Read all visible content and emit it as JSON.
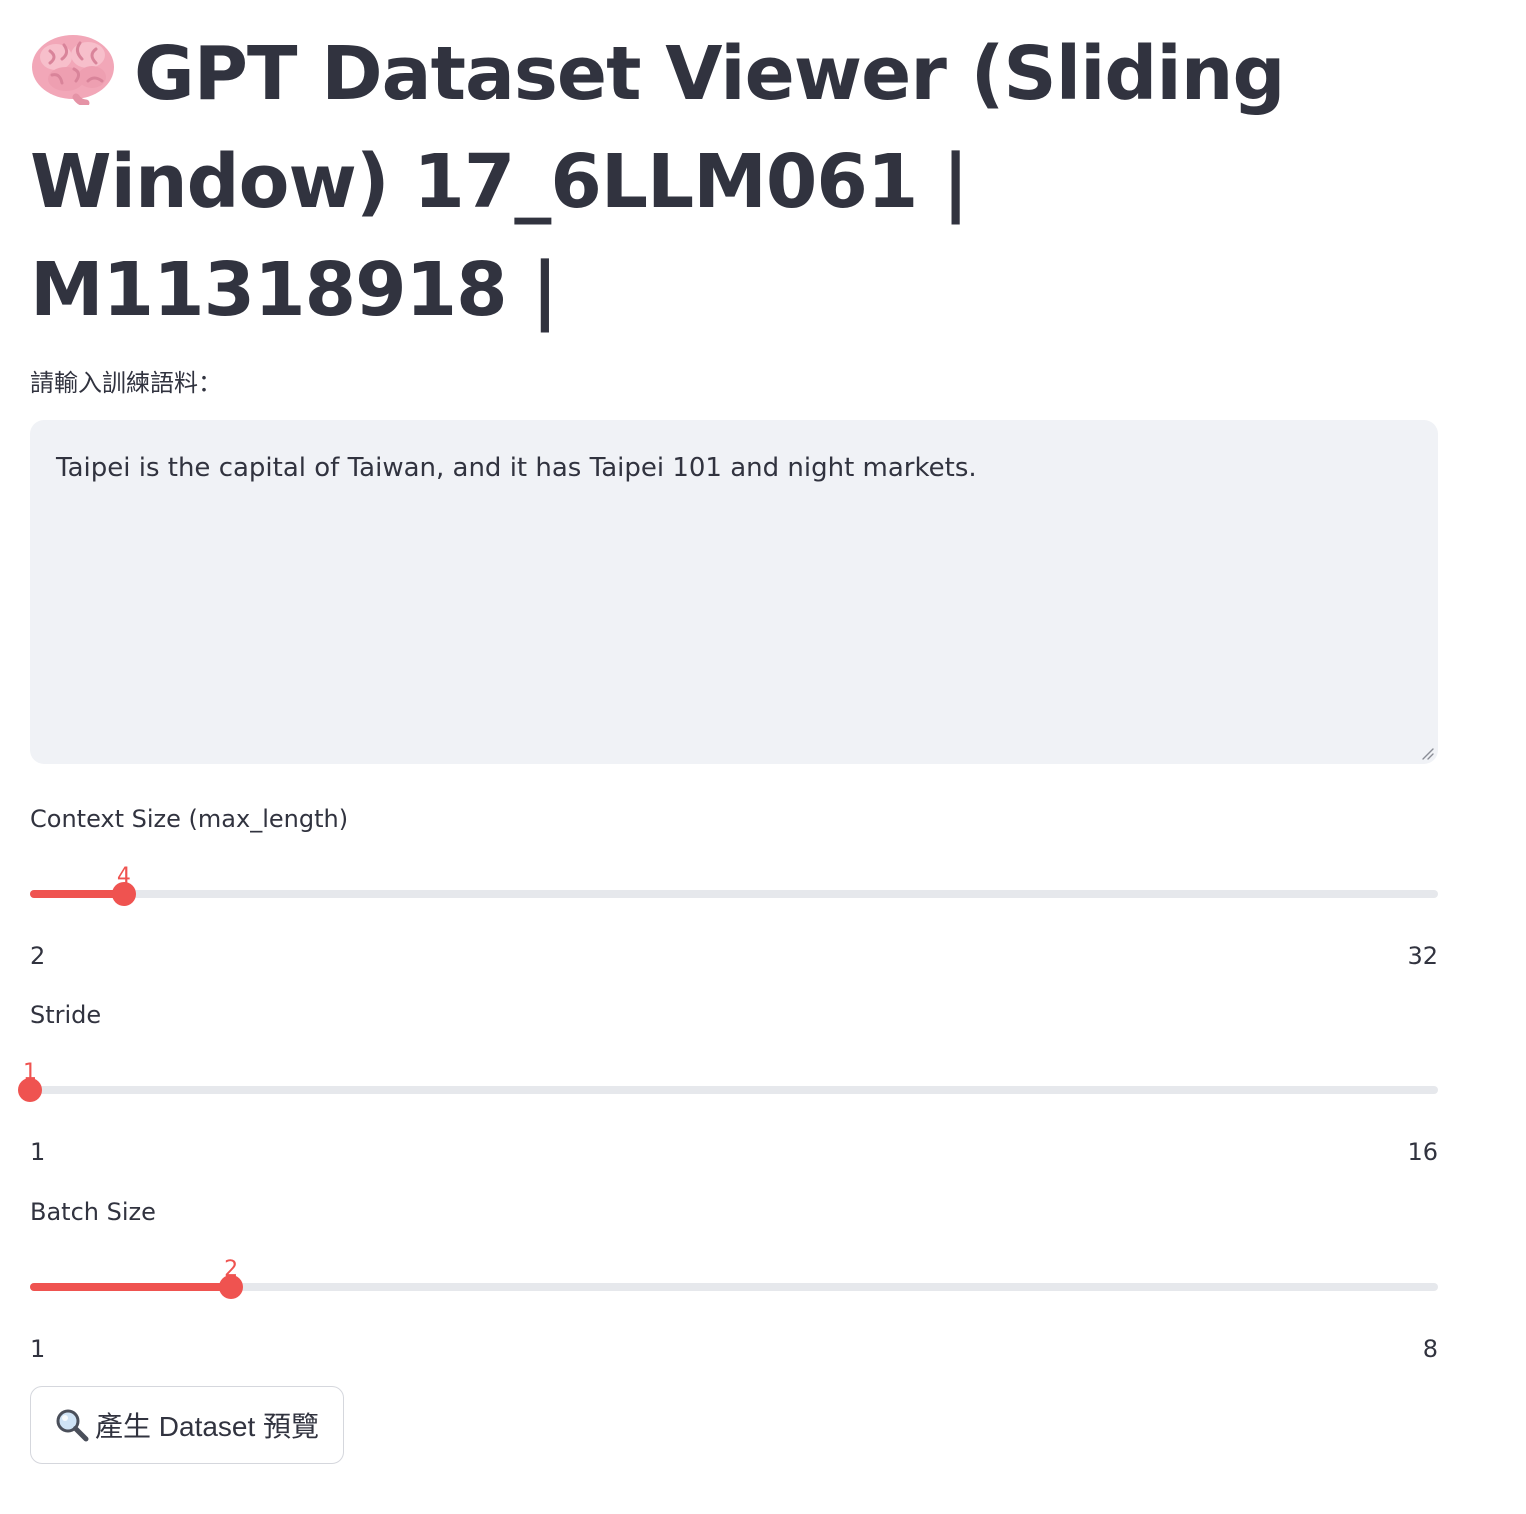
{
  "header": {
    "title_icon": "brain-icon",
    "title": "GPT Dataset Viewer (Sliding Window) 17_6LLM061 | M11318918 |"
  },
  "corpus": {
    "label": "請輸入訓練語料：",
    "value": "Taipei is the capital of Taiwan, and it has Taipei 101 and night markets."
  },
  "sliders": {
    "context_size": {
      "label": "Context Size (max_length)",
      "value": 4,
      "min": 2,
      "max": 32,
      "value_text": "4",
      "min_text": "2",
      "max_text": "32"
    },
    "stride": {
      "label": "Stride",
      "value": 1,
      "min": 1,
      "max": 16,
      "value_text": "1",
      "min_text": "1",
      "max_text": "16"
    },
    "batch_size": {
      "label": "Batch Size",
      "value": 2,
      "min": 1,
      "max": 8,
      "value_text": "2",
      "min_text": "1",
      "max_text": "8"
    }
  },
  "generate_button": {
    "icon": "magnifier-icon",
    "label": "產生 Dataset 預覽"
  },
  "colors": {
    "accent": "#ef5350",
    "text": "#31333f",
    "input_bg": "#f0f2f6",
    "track": "#e6e8ec"
  }
}
